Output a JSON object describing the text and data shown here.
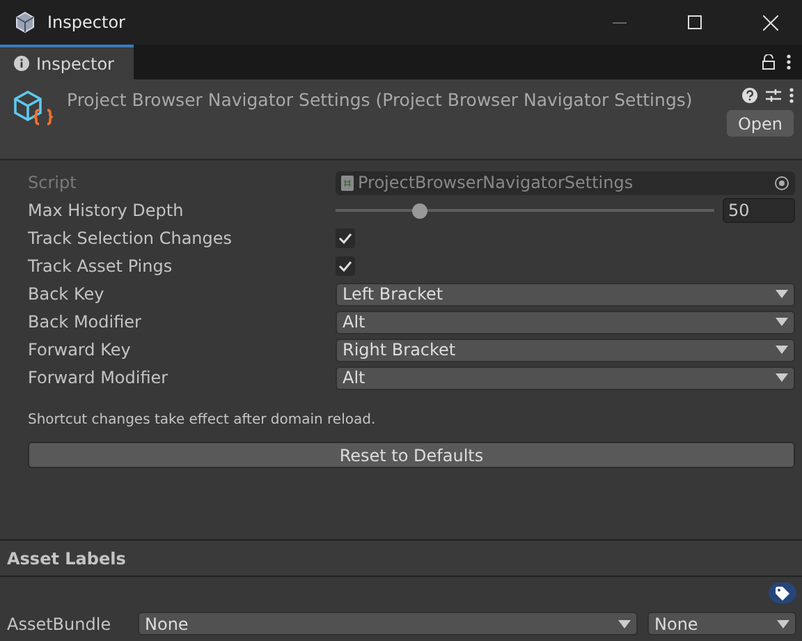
{
  "window": {
    "title": "Inspector"
  },
  "tabs": [
    {
      "label": "Inspector",
      "selected": true
    }
  ],
  "header": {
    "title": "Project Browser Navigator Settings (Project Browser Navigator Settings)",
    "open_button": "Open"
  },
  "fields": [
    {
      "kind": "script",
      "label": "Script",
      "value": "ProjectBrowserNavigatorSettings",
      "disabled": true
    },
    {
      "kind": "slider",
      "label": "Max History Depth",
      "level": 0.22,
      "value": "50"
    },
    {
      "kind": "toggle",
      "label": "Track Selection Changes",
      "checked": true
    },
    {
      "kind": "toggle",
      "label": "Track Asset Pings",
      "checked": true
    },
    {
      "kind": "dropdown",
      "label": "Back Key",
      "value": "Left Bracket"
    },
    {
      "kind": "dropdown",
      "label": "Back Modifier",
      "value": "Alt"
    },
    {
      "kind": "dropdown",
      "label": "Forward Key",
      "value": "Right Bracket"
    },
    {
      "kind": "dropdown",
      "label": "Forward Modifier",
      "value": "Alt"
    }
  ],
  "note": "Shortcut changes take effect after domain reload.",
  "reset_button": "Reset to Defaults",
  "asset_labels": {
    "title": "Asset Labels",
    "bundle_label": "AssetBundle",
    "bundle": "None",
    "variant": "None"
  }
}
